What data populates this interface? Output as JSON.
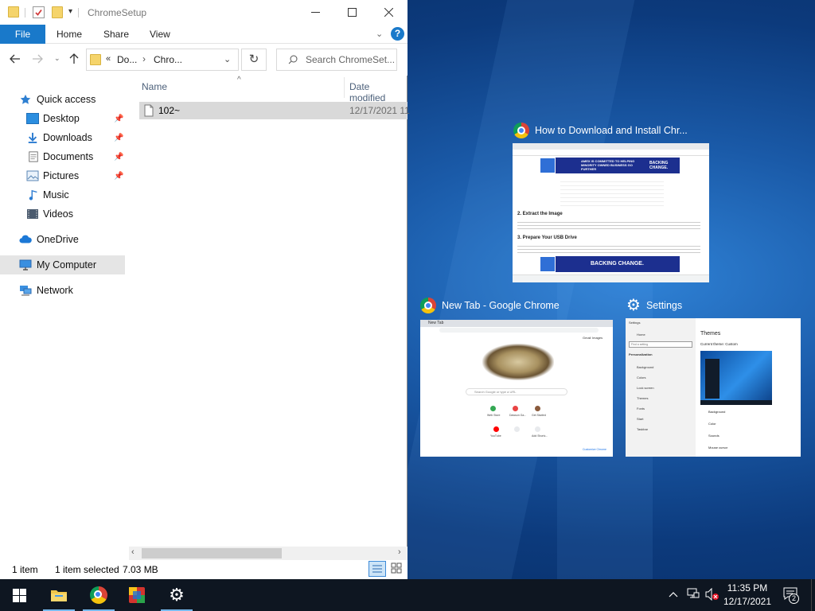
{
  "explorer": {
    "title": "ChromeSetup",
    "ribbon_tabs": [
      "File",
      "Home",
      "Share",
      "View"
    ],
    "address": {
      "part1": "Do...",
      "part2": "Chro..."
    },
    "search_placeholder": "Search ChromeSet...",
    "nav": {
      "quick_access": "Quick access",
      "desktop": "Desktop",
      "downloads": "Downloads",
      "documents": "Documents",
      "pictures": "Pictures",
      "music": "Music",
      "videos": "Videos",
      "onedrive": "OneDrive",
      "my_computer": "My Computer",
      "network": "Network"
    },
    "columns": {
      "name": "Name",
      "date_modified": "Date modified"
    },
    "file": {
      "name": "102~",
      "date": "12/17/2021 11"
    },
    "status": {
      "count": "1 item",
      "selected": "1 item selected",
      "size": "7.03 MB"
    }
  },
  "task_view": {
    "windows": [
      {
        "title": "How to Download and Install Chr...",
        "icon": "chrome-icon"
      },
      {
        "title": "New Tab - Google Chrome",
        "icon": "chrome-icon"
      },
      {
        "title": "Settings",
        "icon": "gear-icon"
      }
    ],
    "article": {
      "ad_left": "AMEX IS COMMITTED TO HELPING MINORITY OWNED BUSINESS GO FURTHER",
      "ad_right": "BACKING CHANGE.",
      "heading2": "2. Extract the Image",
      "heading3": "3. Prepare Your USB Drive",
      "ad2": "BACKING CHANGE."
    },
    "newtab": {
      "tab_label": "New Tab",
      "search_placeholder": "Search Google or type a URL",
      "gmail": "Gmail",
      "images": "Images",
      "shortcuts": [
        "Web Store",
        "Dawson Ga...",
        "Get Started",
        "YouTube",
        "Add Shortc..."
      ],
      "customize": "Customize Chrome"
    },
    "settings": {
      "app": "Settings",
      "home": "Home",
      "find": "Find a setting",
      "section": "Personalization",
      "items": [
        "Background",
        "Colors",
        "Lock screen",
        "Themes",
        "Fonts",
        "Start",
        "Taskbar"
      ],
      "heading": "Themes",
      "current": "Current theme: Custom",
      "opt_background": "Background",
      "opt_color": "Color",
      "opt_sounds": "Sounds",
      "opt_cursor": "Mouse cursor"
    }
  },
  "taskbar": {
    "time": "11:35 PM",
    "date": "12/17/2021",
    "notification_count": "2"
  },
  "colors": {
    "accent": "#1979ca",
    "taskbar": "#0e1621",
    "desktop": "#1a5aa8"
  }
}
